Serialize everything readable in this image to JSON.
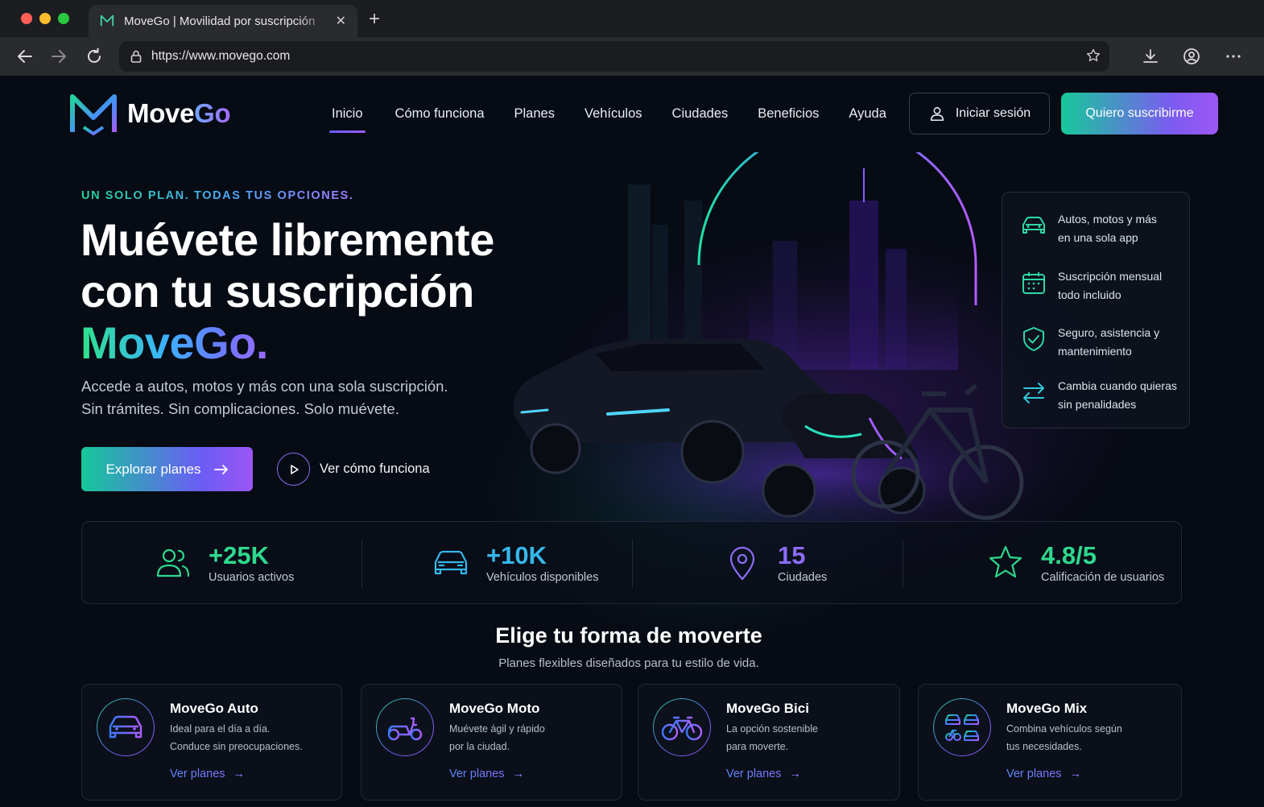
{
  "browser": {
    "tab_title": "MoveGo | Movilidad por suscripción",
    "url": "https://www.movego.com"
  },
  "header": {
    "logo_move": "Move",
    "logo_go": "Go",
    "nav": [
      "Inicio",
      "Cómo funciona",
      "Planes",
      "Vehículos",
      "Ciudades",
      "Beneficios",
      "Ayuda"
    ],
    "active_nav": "Inicio",
    "login_label": "Iniciar sesión",
    "subscribe_label": "Quiero suscribirme"
  },
  "hero": {
    "eyebrow": "UN SOLO PLAN. TODAS TUS OPCIONES.",
    "title_line1": "Muévete libremente",
    "title_line2": "con tu suscripción",
    "title_brand": "MoveGo.",
    "subtitle_line1": "Accede a autos, motos y más con una sola suscripción.",
    "subtitle_line2": "Sin trámites. Sin complicaciones. Solo muévete.",
    "explore_label": "Explorar planes",
    "howto_label": "Ver cómo funciona"
  },
  "features": [
    {
      "icon": "car-icon",
      "line1": "Autos, motos y más",
      "line2": "en una sola app"
    },
    {
      "icon": "calendar-icon",
      "line1": "Suscripción mensual",
      "line2": "todo incluido"
    },
    {
      "icon": "shield-check-icon",
      "line1": "Seguro, asistencia y",
      "line2": "mantenimiento"
    },
    {
      "icon": "swap-arrows-icon",
      "line1": "Cambia cuando quieras",
      "line2": "sin penalidades"
    }
  ],
  "stats": [
    {
      "icon": "users-icon",
      "value": "+25K",
      "label": "Usuarios activos",
      "color": "#2fd88e"
    },
    {
      "icon": "car-icon",
      "value": "+10K",
      "label": "Vehículos disponibles",
      "color": "#35b7ea"
    },
    {
      "icon": "location-pin-icon",
      "value": "15",
      "label": "Ciudades",
      "color": "#8b6cf6"
    },
    {
      "icon": "star-icon",
      "value": "4.8/5",
      "label": "Calificación de usuarios",
      "color": "#2fd88e"
    }
  ],
  "section": {
    "title": "Elige tu forma de moverte",
    "subtitle": "Planes flexibles diseñados para tu estilo de vida."
  },
  "plans": [
    {
      "icon": "car-icon",
      "title": "MoveGo Auto",
      "desc1": "Ideal para el día a día.",
      "desc2": "Conduce sin preocupaciones.",
      "link": "Ver planes"
    },
    {
      "icon": "scooter-icon",
      "title": "MoveGo Moto",
      "desc1": "Muévete ágil y rápido",
      "desc2": "por la ciudad.",
      "link": "Ver planes"
    },
    {
      "icon": "bicycle-icon",
      "title": "MoveGo Bici",
      "desc1": "La opción sostenible",
      "desc2": "para moverte.",
      "link": "Ver planes"
    },
    {
      "icon": "mixed-vehicles-icon",
      "title": "MoveGo Mix",
      "desc1": "Combina vehículos según",
      "desc2": "tus necesidades.",
      "link": "Ver planes"
    }
  ],
  "colors": {
    "accent_green": "#1fd49a",
    "accent_purple": "#9c56f5",
    "background": "#070b14"
  }
}
